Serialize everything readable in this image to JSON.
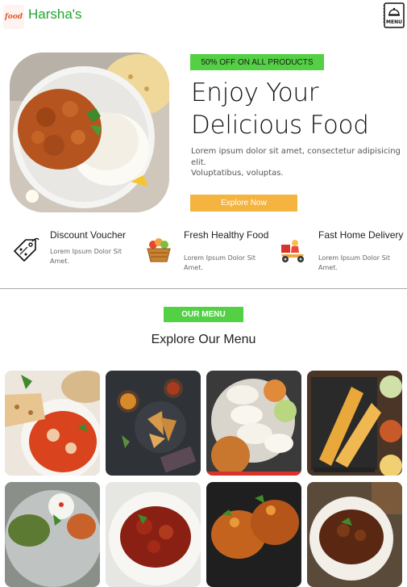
{
  "header": {
    "brand": "Harsha's",
    "logo_text": "food",
    "menu_icon_text": "MENU"
  },
  "hero": {
    "promo": "50% OFF ON ALL PRODUCTS",
    "title_line1": "Enjoy Your",
    "title_line2": "Delicious Food",
    "text_line1": "Lorem ipsum dolor sit amet, consectetur adipisicing elit.",
    "text_line2": "Voluptatibus, voluptas.",
    "button": "Explore Now"
  },
  "features": [
    {
      "title": "Discount Voucher",
      "desc": "Lorem Ipsum Dolor Sit Amet.",
      "icon": "discount-tag-icon"
    },
    {
      "title": "Fresh Healthy Food",
      "desc": "Lorem Ipsum Dolor Sit Amet.",
      "icon": "food-basket-icon"
    },
    {
      "title": "Fast Home Delivery",
      "desc": "Lorem Ipsum Dolor Sit Amet.",
      "icon": "delivery-scooter-icon"
    }
  ],
  "menu_section": {
    "badge": "OUR MENU",
    "heading": "Explore Our Menu"
  },
  "colors": {
    "brand_green": "#22a52f",
    "accent_green": "#54d045",
    "accent_orange": "#f5b43f"
  }
}
